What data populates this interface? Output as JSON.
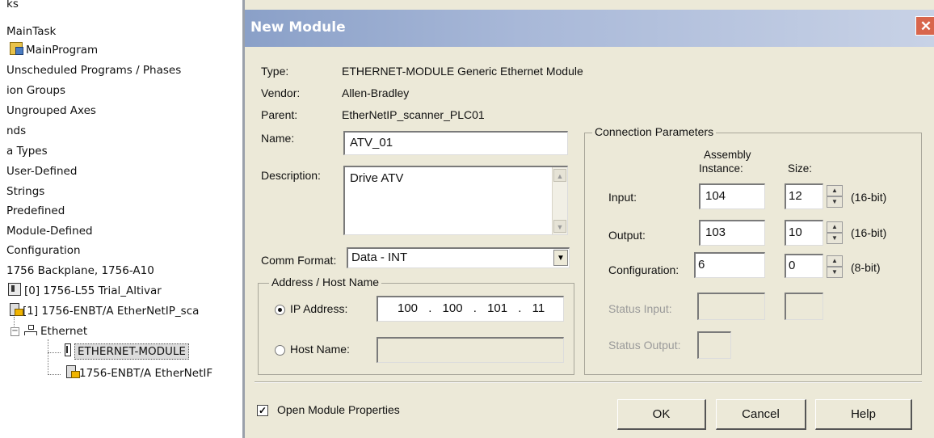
{
  "tree": {
    "items": [
      {
        "label": "ks"
      },
      {
        "label": "MainTask"
      },
      {
        "label": "MainProgram"
      },
      {
        "label": "Unscheduled Programs / Phases"
      },
      {
        "label": "ion Groups"
      },
      {
        "label": "Ungrouped Axes"
      },
      {
        "label": "nds"
      },
      {
        "label": "a Types"
      },
      {
        "label": "User-Defined"
      },
      {
        "label": "Strings"
      },
      {
        "label": "Predefined"
      },
      {
        "label": "Module-Defined"
      },
      {
        "label": "Configuration"
      },
      {
        "label": "1756 Backplane, 1756-A10"
      },
      {
        "label": "[0] 1756-L55 Trial_Altivar"
      },
      {
        "label": "[1] 1756-ENBT/A EtherNetIP_sca"
      },
      {
        "label": "Ethernet"
      },
      {
        "label": "ETHERNET-MODULE"
      },
      {
        "label": "1756-ENBT/A EtherNetIF"
      }
    ]
  },
  "dialog": {
    "title": "New Module",
    "close_label": "✕",
    "type_label": "Type:",
    "type_value": "ETHERNET-MODULE Generic Ethernet Module",
    "vendor_label": "Vendor:",
    "vendor_value": "Allen-Bradley",
    "parent_label": "Parent:",
    "parent_value": "EtherNetIP_scanner_PLC01",
    "name_label": "Name:",
    "name_value": "ATV_01",
    "description_label": "Description:",
    "description_value": "Drive ATV",
    "comm_format_label": "Comm Format:",
    "comm_format_value": "Data - INT",
    "address_group_title": "Address / Host Name",
    "ip_address_label": "IP Address:",
    "ip_octets": [
      "100",
      "100",
      "101",
      "11"
    ],
    "host_name_label": "Host Name:",
    "host_name_value": "",
    "connection": {
      "group_title": "Connection Parameters",
      "assembly_header": "Assembly",
      "instance_header": "Instance:",
      "size_header": "Size:",
      "input_label": "Input:",
      "input_instance": "104",
      "input_size": "12",
      "input_unit": "(16-bit)",
      "output_label": "Output:",
      "output_instance": "103",
      "output_size": "10",
      "output_unit": "(16-bit)",
      "config_label": "Configuration:",
      "config_instance": "6",
      "config_size": "0",
      "config_unit": "(8-bit)",
      "status_input_label": "Status Input:",
      "status_output_label": "Status Output:"
    },
    "open_props_label": "Open Module Properties",
    "open_props_checked": true,
    "ok_label": "OK",
    "cancel_label": "Cancel",
    "help_label": "Help"
  }
}
